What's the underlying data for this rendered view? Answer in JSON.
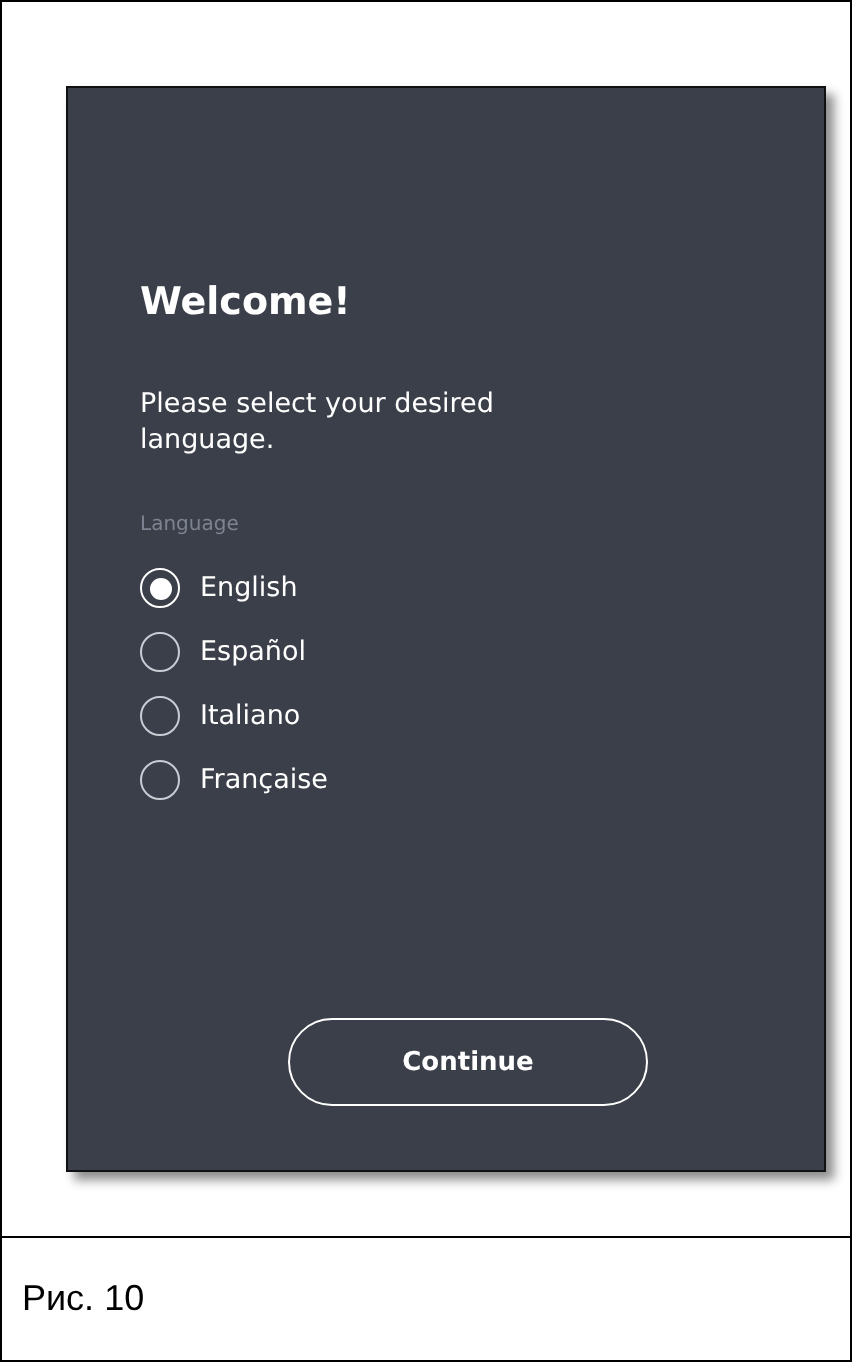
{
  "screen": {
    "title": "Welcome!",
    "prompt": "Please select your desired language.",
    "field_label": "Language",
    "options": [
      {
        "label": "English",
        "selected": true
      },
      {
        "label": "Español",
        "selected": false
      },
      {
        "label": "Italiano",
        "selected": false
      },
      {
        "label": "Française",
        "selected": false
      }
    ],
    "button": "Continue"
  },
  "caption": "Рис. 10"
}
